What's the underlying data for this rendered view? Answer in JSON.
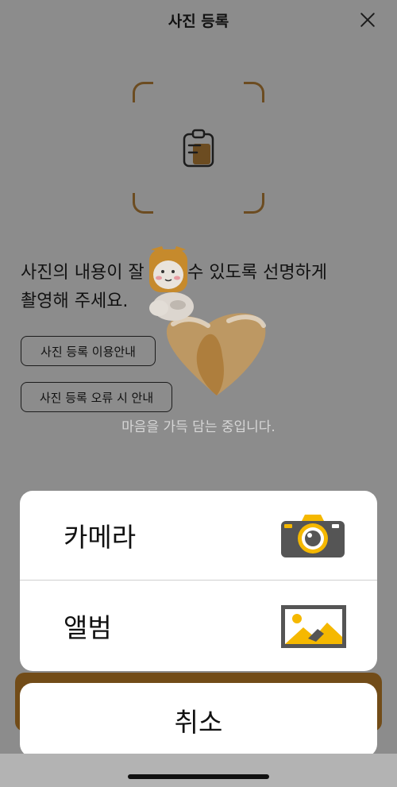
{
  "header": {
    "title": "사진 등록"
  },
  "description": {
    "line1": "사진의 내용이 잘 보일 수 있도록 선명하게",
    "line2": "촬영해 주세요."
  },
  "guide_buttons": {
    "usage_label": "사진 등록 이용안내",
    "error_label": "사진 등록 오류 시 안내"
  },
  "loading": {
    "text": "마음을 가득 담는 중입니다."
  },
  "action_sheet": {
    "camera_label": "카메라",
    "album_label": "앨범",
    "cancel_label": "취소"
  },
  "icons": {
    "close": "close-icon",
    "clipboard": "clipboard-icon",
    "camera": "camera-icon",
    "album": "picture-icon",
    "loader": "heart-loading-icon"
  },
  "colors": {
    "accent": "#d08a2c",
    "frame_corner": "#c58a3c",
    "camera_yellow": "#f5b800",
    "sheet_bg": "#ffffff"
  }
}
